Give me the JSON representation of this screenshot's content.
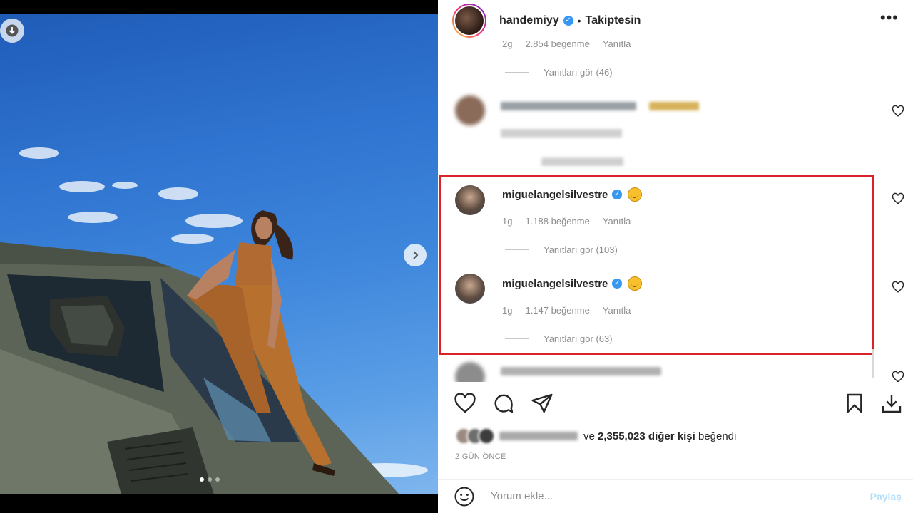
{
  "post": {
    "photo_count": 3,
    "active_photo_index": 0
  },
  "header": {
    "username": "handemiyy",
    "separator": "•",
    "follow_status": "Takiptesin",
    "more_label": "•••"
  },
  "comments": [
    {
      "id": "partial-top",
      "age": "2g",
      "likes": "2.854 beğenme",
      "reply_label": "Yanıtla",
      "view_replies": "Yanıtları gör (46)"
    },
    {
      "id": "blurred-1",
      "blurred": true
    },
    {
      "id": "miguel-1",
      "username": "miguelangelsilvestre",
      "age": "1g",
      "likes": "1.188 beğenme",
      "reply_label": "Yanıtla",
      "view_replies": "Yanıtları gör (103)"
    },
    {
      "id": "miguel-2",
      "username": "miguelangelsilvestre",
      "age": "1g",
      "likes": "1.147 beğenme",
      "reply_label": "Yanıtla",
      "view_replies": "Yanıtları gör (63)"
    },
    {
      "id": "blurred-2",
      "blurred": true
    }
  ],
  "likes_summary": {
    "connector": "ve",
    "count": "2,355,023",
    "suffix": "diğer kişi",
    "verb": "beğendi"
  },
  "timestamp": "2 GÜN ÖNCE",
  "add_comment": {
    "placeholder": "Yorum ekle...",
    "post_label": "Paylaş"
  },
  "colors": {
    "highlight_border": "#d9232a",
    "verified": "#3897f0",
    "post_button_disabled": "#b2dffc"
  },
  "icons": [
    "download-icon",
    "chevron-right-icon",
    "heart-icon",
    "comment-icon",
    "share-icon",
    "bookmark-icon",
    "smile-icon",
    "verified-icon"
  ]
}
